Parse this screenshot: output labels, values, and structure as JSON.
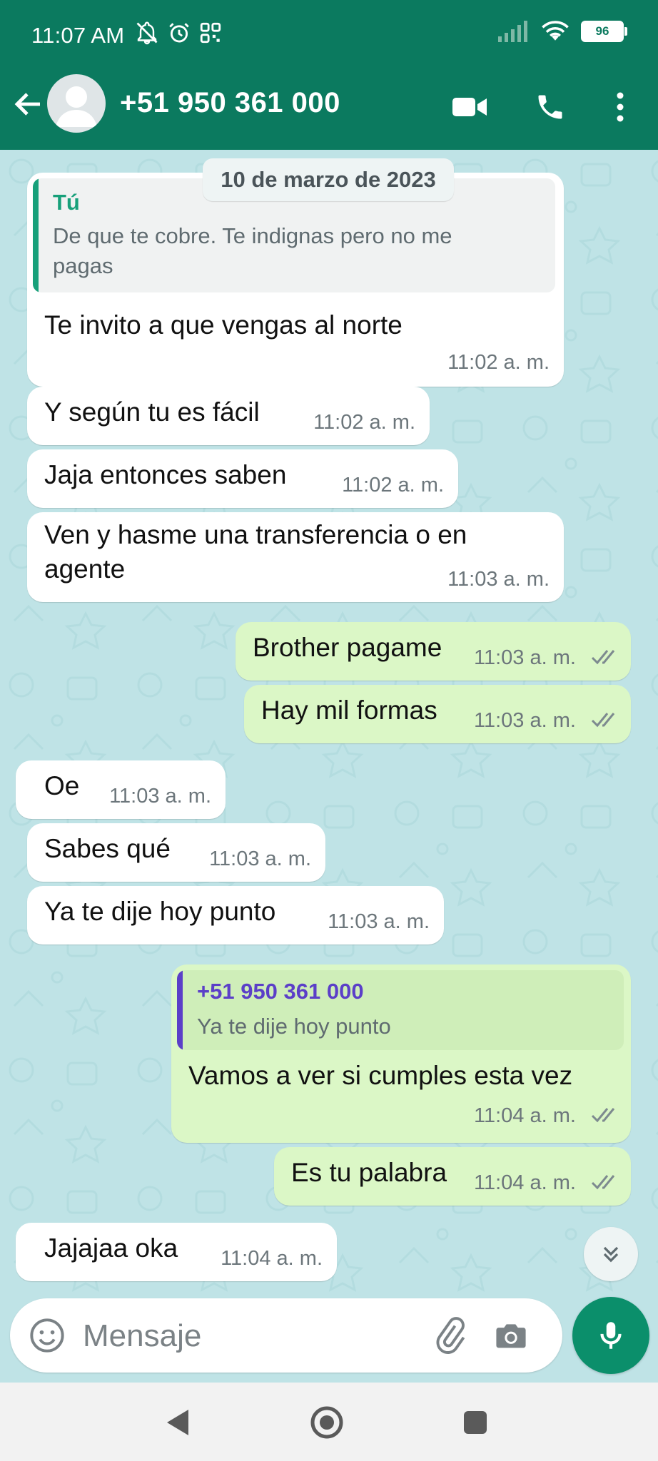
{
  "status_bar": {
    "time": "11:07 AM",
    "battery": "96"
  },
  "header": {
    "contact": "+51 950 361 000",
    "icons": [
      "back-arrow-icon",
      "avatar",
      "video-call-icon",
      "phone-icon",
      "more-vert-icon"
    ],
    "color": "#0b7a5f"
  },
  "chat": {
    "date_chip": "10 de marzo de 2023",
    "messages": [
      {
        "dir": "in",
        "quote_author": "Tú",
        "quote_text_line1": "De que te cobre. Te indignas pero no me",
        "quote_text_line2": "pagas",
        "text": "Te invito a que vengas al norte",
        "time": "11:02 a. m."
      },
      {
        "dir": "in",
        "text": "Y según tu es fácil",
        "time": "11:02 a. m."
      },
      {
        "dir": "in",
        "text": "Jaja entonces saben",
        "time": "11:02 a. m."
      },
      {
        "dir": "in",
        "text_line1": "Ven y hasme una transferencia o en",
        "text_line2": "agente",
        "time": "11:03 a. m."
      },
      {
        "dir": "out",
        "text": "Brother pagame",
        "time": "11:03 a. m."
      },
      {
        "dir": "out",
        "text": "Hay mil formas",
        "time": "11:03 a. m."
      },
      {
        "dir": "in",
        "text": "Oe",
        "time": "11:03 a. m."
      },
      {
        "dir": "in",
        "text": "Sabes qué",
        "time": "11:03 a. m."
      },
      {
        "dir": "in",
        "text": "Ya te dije hoy punto",
        "time": "11:03 a. m."
      },
      {
        "dir": "out",
        "quote_author": "+51 950 361 000",
        "quote_text": "Ya te dije hoy punto",
        "text": "Vamos a ver si cumples esta vez",
        "time": "11:04 a. m."
      },
      {
        "dir": "out",
        "text": "Es tu palabra",
        "time": "11:04 a. m."
      },
      {
        "dir": "in",
        "text": "Jajajaa oka",
        "time": "11:04 a. m."
      }
    ]
  },
  "composer": {
    "placeholder": "Mensaje"
  },
  "colors": {
    "header": "#0b7a5f",
    "chat_bg": "#bfe3e6",
    "outgoing": "#dbf7c6",
    "incoming": "#ffffff",
    "mic": "#0b8f6b",
    "quote_you": "#17a07a",
    "quote_contact": "#5b3fc8"
  }
}
